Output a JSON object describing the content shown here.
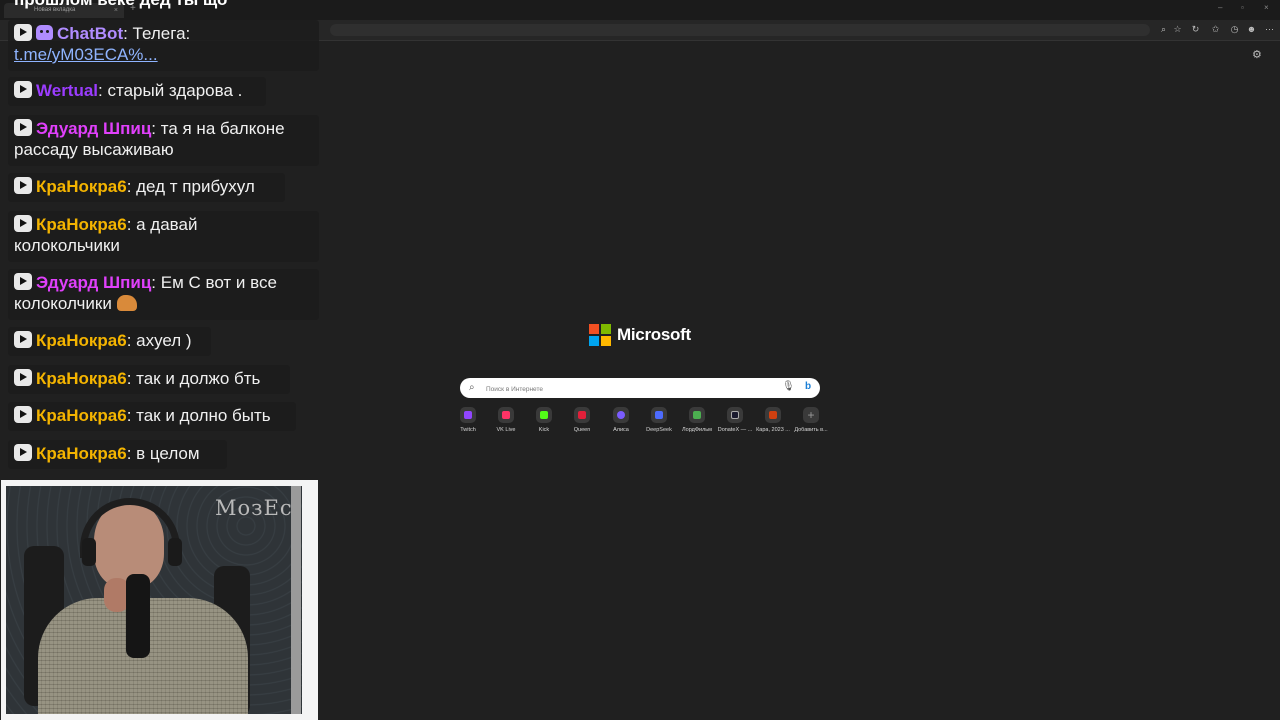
{
  "browser": {
    "tab_title": "Новая вкладка",
    "tab_close": "×",
    "new_tab": "+",
    "window_controls": [
      "–",
      "▫",
      "×"
    ]
  },
  "newtab": {
    "brand": "Microsoft",
    "brand_colors": [
      "#f25022",
      "#7fba00",
      "#00a4ef",
      "#ffb900"
    ],
    "search_placeholder": "Поиск в Интернете",
    "shortcuts": [
      {
        "label": "Twitch",
        "color": "#9146ff"
      },
      {
        "label": "VK Live",
        "color": "#ff3366"
      },
      {
        "label": "Kick",
        "color": "#53fc18"
      },
      {
        "label": "Queen",
        "color": "#e0203a"
      },
      {
        "label": "Алиса",
        "color": "#7b5cff"
      },
      {
        "label": "DeepSeek",
        "color": "#4d6bfe"
      },
      {
        "label": "ЛордФильм",
        "color": "#4caf50"
      },
      {
        "label": "DonateX — ...",
        "color": "#1a1a2e"
      },
      {
        "label": "Кара, 2023 ...",
        "color": "#d04010"
      },
      {
        "label": "Добавить в...",
        "color": "#555555"
      }
    ]
  },
  "chat": {
    "cut_top": "прошлом веке дед ты що",
    "messages": [
      {
        "user": "ChatBot",
        "color": "#b08cff",
        "text": ": Телега:",
        "line2": "t.me/yM03ECA%..."
      },
      {
        "user": "Wertual",
        "color": "#9b3cff",
        "text": ": старый здарова ."
      },
      {
        "user": "Эдуард Шпиц",
        "color": "#e040fb",
        "text": ": та я на балконе",
        "line2": "рассаду высаживаю"
      },
      {
        "user": "КраНокра6",
        "color": "#f4b400",
        "text": ": дед т прибухул"
      },
      {
        "user": "КраНокра6",
        "color": "#f4b400",
        "text": ": а давай",
        "line2": "колокольчики"
      },
      {
        "user": "Эдуард Шпиц",
        "color": "#e040fb",
        "text": ": Ем С вот и все",
        "line2": "колоколчики"
      },
      {
        "user": "КраНокра6",
        "color": "#f4b400",
        "text": ": ахуел )"
      },
      {
        "user": "КраНокра6",
        "color": "#f4b400",
        "text": ": так и должо бть"
      },
      {
        "user": "КраНокра6",
        "color": "#f4b400",
        "text": ": так и долно быть"
      },
      {
        "user": "КраНокра6",
        "color": "#f4b400",
        "text": ": в целом"
      }
    ]
  },
  "webcam": {
    "name": "МозЕс"
  }
}
